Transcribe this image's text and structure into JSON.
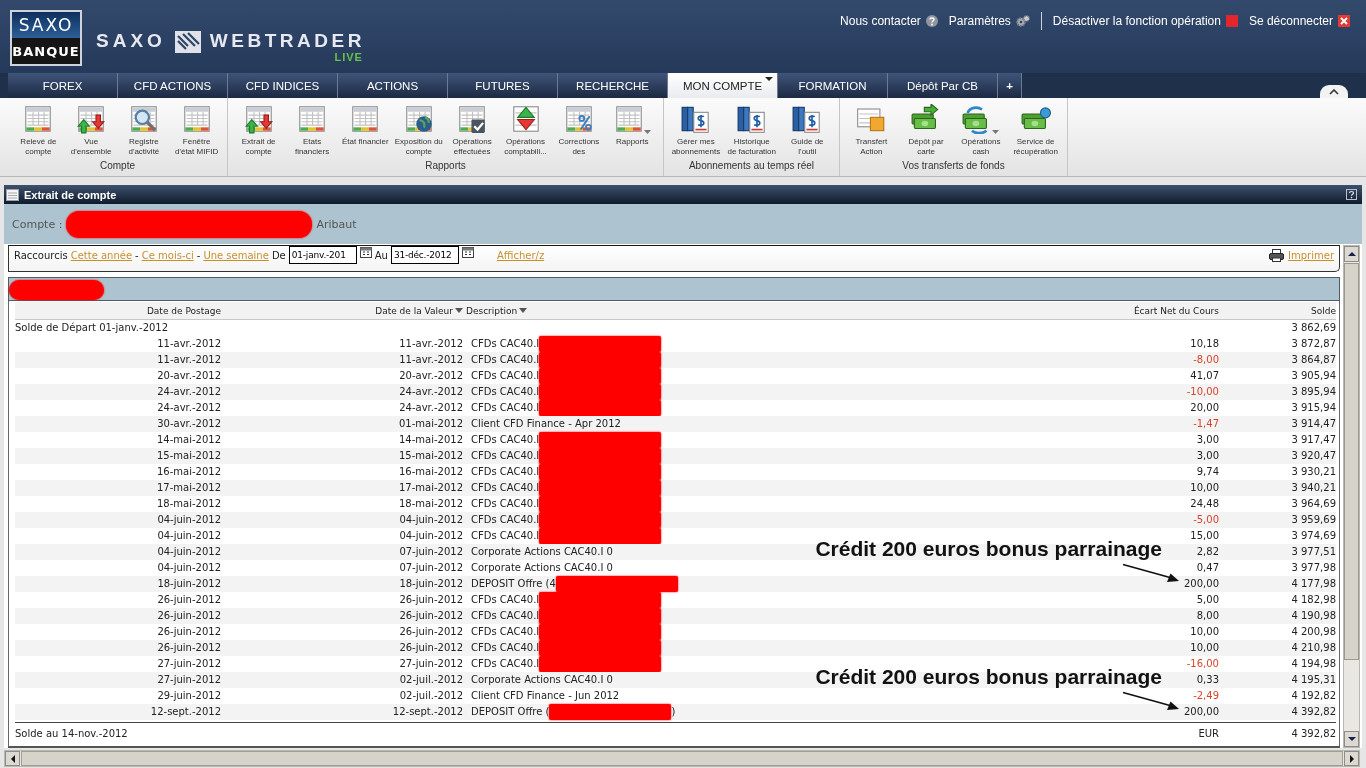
{
  "header": {
    "logo": {
      "top": "SAXO",
      "bottom": "BANQUE"
    },
    "brand": {
      "left": "SAXO",
      "right": "WEBTRADER",
      "edition": "LIVE"
    },
    "links": [
      {
        "label": "Nous contacter"
      },
      {
        "label": "Paramètres"
      },
      {
        "label": "Désactiver la fonction opération"
      },
      {
        "label": "Se déconnecter"
      }
    ]
  },
  "tabs": [
    {
      "label": "FOREX",
      "selected": false,
      "kind": "page"
    },
    {
      "label": "CFD ACTIONS",
      "selected": false,
      "kind": "page"
    },
    {
      "label": "CFD INDICES",
      "selected": false,
      "kind": "page"
    },
    {
      "label": "ACTIONS",
      "selected": false,
      "kind": "page"
    },
    {
      "label": "FUTURES",
      "selected": false,
      "kind": "page"
    },
    {
      "label": "RECHERCHE",
      "selected": false,
      "kind": "page"
    },
    {
      "label": "MON COMPTE",
      "selected": true,
      "kind": "page"
    },
    {
      "label": "FORMATION",
      "selected": false,
      "kind": "page"
    },
    {
      "label": "Dépôt Par CB",
      "selected": false,
      "kind": "page"
    },
    {
      "label": "+",
      "selected": false,
      "kind": "add"
    }
  ],
  "ribbon": {
    "groups": [
      {
        "title": "Compte",
        "items": [
          {
            "label": "Relevé de\ncompte",
            "dropdown": false
          },
          {
            "label": "Vue\nd'ensemble",
            "dropdown": false
          },
          {
            "label": "Registre\nd'activité",
            "dropdown": false
          },
          {
            "label": "Fenêtre\nd'état MIFID",
            "dropdown": false
          }
        ]
      },
      {
        "title": "Rapports",
        "items": [
          {
            "label": "Extrait de\ncompte",
            "dropdown": false
          },
          {
            "label": "Etats\nfinanciers",
            "dropdown": false
          },
          {
            "label": "État financier",
            "dropdown": false
          },
          {
            "label": "Exposition du\ncompte",
            "dropdown": false
          },
          {
            "label": "Opérations\neffectuées",
            "dropdown": false
          },
          {
            "label": "Opérations\ncomptabili...",
            "dropdown": false
          },
          {
            "label": "Corrections\ndes",
            "dropdown": false
          },
          {
            "label": "Rapports",
            "dropdown": true
          }
        ]
      },
      {
        "title": "Abonnements au temps réel",
        "items": [
          {
            "label": "Gérer mes\nabonnements",
            "dropdown": false
          },
          {
            "label": "Historique\nde facturation",
            "dropdown": false
          },
          {
            "label": "Guide de\nl'outil",
            "dropdown": false
          }
        ]
      },
      {
        "title": "Vos transferts de fonds",
        "items": [
          {
            "label": "Transfert\nAction",
            "dropdown": false
          },
          {
            "label": "Dépôt par\ncarte",
            "dropdown": false
          },
          {
            "label": "Opérations\ncash",
            "dropdown": true
          },
          {
            "label": "Service de\nrécupération",
            "dropdown": false
          }
        ]
      }
    ]
  },
  "panel": {
    "title": "Extrait de compte"
  },
  "account": {
    "label": "Compte :",
    "redacted": true,
    "holder": "Aribaut"
  },
  "filter": {
    "items": [
      {
        "kind": "text",
        "text": "Raccourcis"
      },
      {
        "kind": "link",
        "text": "Cette année"
      },
      {
        "kind": "text",
        "text": "-"
      },
      {
        "kind": "link",
        "text": "Ce mois-ci"
      },
      {
        "kind": "text",
        "text": "-"
      },
      {
        "kind": "link",
        "text": "Une semaine"
      },
      {
        "kind": "text",
        "text": "De"
      },
      {
        "kind": "date",
        "text": "01-janv.-201"
      },
      {
        "kind": "text",
        "text": "Au"
      },
      {
        "kind": "date",
        "text": "31-déc.-2012"
      },
      {
        "kind": "link",
        "text": "Afficher/z"
      }
    ],
    "print": "Imprimer"
  },
  "group_bar": {
    "redacted": true
  },
  "table": {
    "columns": [
      {
        "label": "Date de Postage",
        "sortable": false
      },
      {
        "label": "Date de la Valeur",
        "sortable": true
      },
      {
        "label": "Description",
        "sortable": true
      },
      {
        "label": "Écart Net du Cours",
        "sortable": false
      },
      {
        "label": "Solde",
        "sortable": false
      }
    ],
    "opening": {
      "label": "Solde de Départ 01-janv.-2012",
      "balance": "3 862,69"
    },
    "rows": [
      {
        "posted": "11-avr.-2012",
        "value_date": "11-avr.-2012",
        "description": "CFDs CAC40.I",
        "redacted": true,
        "net": "10,18",
        "negative": false,
        "balance": "3 872,87"
      },
      {
        "posted": "11-avr.-2012",
        "value_date": "11-avr.-2012",
        "description": "CFDs CAC40.I",
        "redacted": true,
        "net": "-8,00",
        "negative": true,
        "balance": "3 864,87"
      },
      {
        "posted": "20-avr.-2012",
        "value_date": "20-avr.-2012",
        "description": "CFDs CAC40.I",
        "redacted": true,
        "net": "41,07",
        "negative": false,
        "balance": "3 905,94"
      },
      {
        "posted": "24-avr.-2012",
        "value_date": "24-avr.-2012",
        "description": "CFDs CAC40.I",
        "redacted": true,
        "net": "-10,00",
        "negative": true,
        "balance": "3 895,94"
      },
      {
        "posted": "24-avr.-2012",
        "value_date": "24-avr.-2012",
        "description": "CFDs CAC40.I",
        "redacted": true,
        "net": "20,00",
        "negative": false,
        "balance": "3 915,94"
      },
      {
        "posted": "30-avr.-2012",
        "value_date": "01-mai-2012",
        "description": "Client CFD Finance - Apr 2012",
        "redacted": false,
        "net": "-1,47",
        "negative": true,
        "balance": "3 914,47"
      },
      {
        "posted": "14-mai-2012",
        "value_date": "14-mai-2012",
        "description": "CFDs CAC40.I",
        "redacted": true,
        "net": "3,00",
        "negative": false,
        "balance": "3 917,47"
      },
      {
        "posted": "15-mai-2012",
        "value_date": "15-mai-2012",
        "description": "CFDs CAC40.I",
        "redacted": true,
        "net": "3,00",
        "negative": false,
        "balance": "3 920,47"
      },
      {
        "posted": "16-mai-2012",
        "value_date": "16-mai-2012",
        "description": "CFDs CAC40.I",
        "redacted": true,
        "net": "9,74",
        "negative": false,
        "balance": "3 930,21"
      },
      {
        "posted": "17-mai-2012",
        "value_date": "17-mai-2012",
        "description": "CFDs CAC40.I",
        "redacted": true,
        "net": "10,00",
        "negative": false,
        "balance": "3 940,21"
      },
      {
        "posted": "18-mai-2012",
        "value_date": "18-mai-2012",
        "description": "CFDs CAC40.I",
        "redacted": true,
        "net": "24,48",
        "negative": false,
        "balance": "3 964,69"
      },
      {
        "posted": "04-juin-2012",
        "value_date": "04-juin-2012",
        "description": "CFDs CAC40.I",
        "redacted": true,
        "net": "-5,00",
        "negative": true,
        "balance": "3 959,69"
      },
      {
        "posted": "04-juin-2012",
        "value_date": "04-juin-2012",
        "description": "CFDs CAC40.I",
        "redacted": true,
        "net": "15,00",
        "negative": false,
        "balance": "3 974,69"
      },
      {
        "posted": "04-juin-2012",
        "value_date": "07-juin-2012",
        "description": "Corporate Actions CAC40.I 0",
        "redacted": false,
        "net": "2,82",
        "negative": false,
        "balance": "3 977,51"
      },
      {
        "posted": "04-juin-2012",
        "value_date": "07-juin-2012",
        "description": "Corporate Actions CAC40.I 0",
        "redacted": false,
        "net": "0,47",
        "negative": false,
        "balance": "3 977,98"
      },
      {
        "posted": "18-juin-2012",
        "value_date": "18-juin-2012",
        "description": "DEPOSIT Offre (4",
        "redacted": true,
        "net": "200,00",
        "negative": false,
        "balance": "4 177,98",
        "annotation": "Crédit 200 euros bonus parrainage"
      },
      {
        "posted": "26-juin-2012",
        "value_date": "26-juin-2012",
        "description": "CFDs CAC40.I",
        "redacted": true,
        "net": "5,00",
        "negative": false,
        "balance": "4 182,98"
      },
      {
        "posted": "26-juin-2012",
        "value_date": "26-juin-2012",
        "description": "CFDs CAC40.I",
        "redacted": true,
        "net": "8,00",
        "negative": false,
        "balance": "4 190,98"
      },
      {
        "posted": "26-juin-2012",
        "value_date": "26-juin-2012",
        "description": "CFDs CAC40.I",
        "redacted": true,
        "net": "10,00",
        "negative": false,
        "balance": "4 200,98"
      },
      {
        "posted": "26-juin-2012",
        "value_date": "26-juin-2012",
        "description": "CFDs CAC40.I",
        "redacted": true,
        "net": "10,00",
        "negative": false,
        "balance": "4 210,98"
      },
      {
        "posted": "27-juin-2012",
        "value_date": "27-juin-2012",
        "description": "CFDs CAC40.I",
        "redacted": true,
        "net": "-16,00",
        "negative": true,
        "balance": "4 194,98"
      },
      {
        "posted": "27-juin-2012",
        "value_date": "02-juil.-2012",
        "description": "Corporate Actions CAC40.I 0",
        "redacted": false,
        "net": "0,33",
        "negative": false,
        "balance": "4 195,31"
      },
      {
        "posted": "29-juin-2012",
        "value_date": "02-juil.-2012",
        "description": "Client CFD Finance - Jun 2012",
        "redacted": false,
        "net": "-2,49",
        "negative": true,
        "balance": "4 192,82"
      },
      {
        "posted": "12-sept.-2012",
        "value_date": "12-sept.-2012",
        "description": "DEPOSIT Offre (",
        "redacted": true,
        "description_tail": ")",
        "net": "200,00",
        "negative": false,
        "balance": "4 392,82",
        "annotation": "Crédit 200 euros bonus parrainage"
      }
    ],
    "closing": {
      "label": "Solde au 14-nov.-2012",
      "currency": "EUR",
      "balance": "4 392,82"
    }
  }
}
